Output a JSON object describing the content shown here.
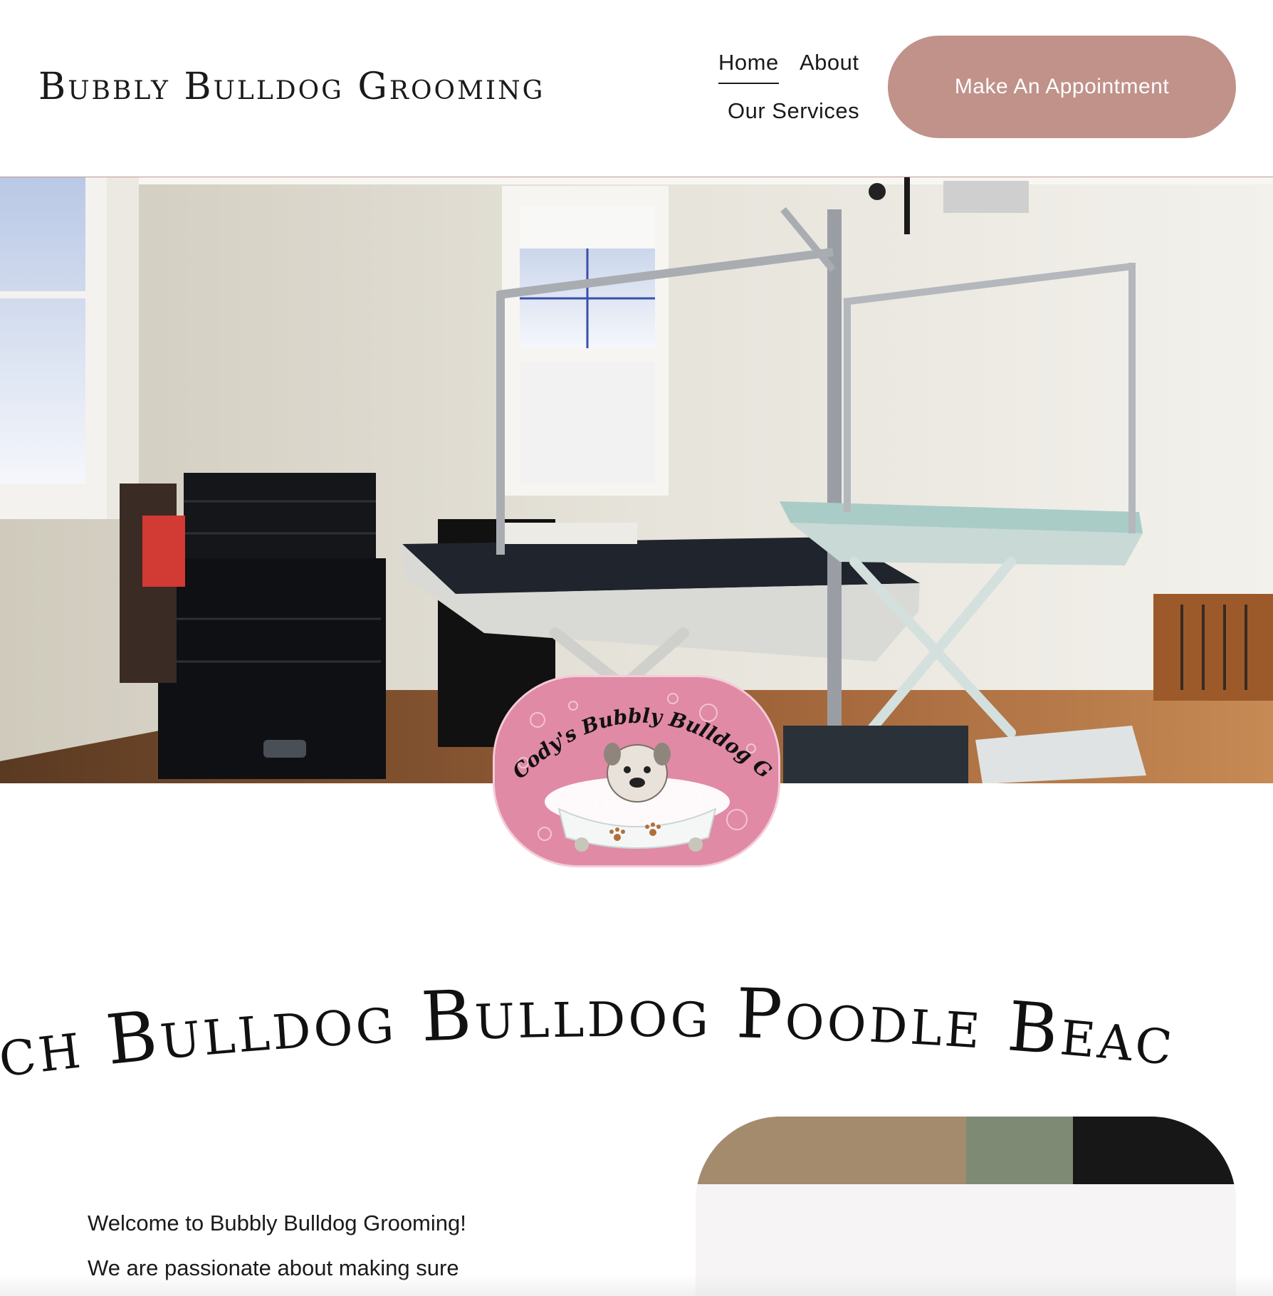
{
  "header": {
    "site_title": "Bubbly Bulldog Grooming",
    "nav": {
      "home": "Home",
      "about": "About",
      "services": "Our Services"
    },
    "cta_label": "Make An Appointment",
    "cta_color": "#c0928a"
  },
  "hero": {
    "image": "grooming-room-photo"
  },
  "logo": {
    "text": "Cody's Bubbly Bulldog Grooming",
    "background_color": "#e08aa6",
    "icon": "bulldog-in-bathtub-logo"
  },
  "marquee": {
    "text": "nch Bulldog Bulldog Poodle Beac"
  },
  "intro": {
    "line1": "Welcome to Bubbly Bulldog Grooming!",
    "line2": "We are passionate about making sure"
  }
}
